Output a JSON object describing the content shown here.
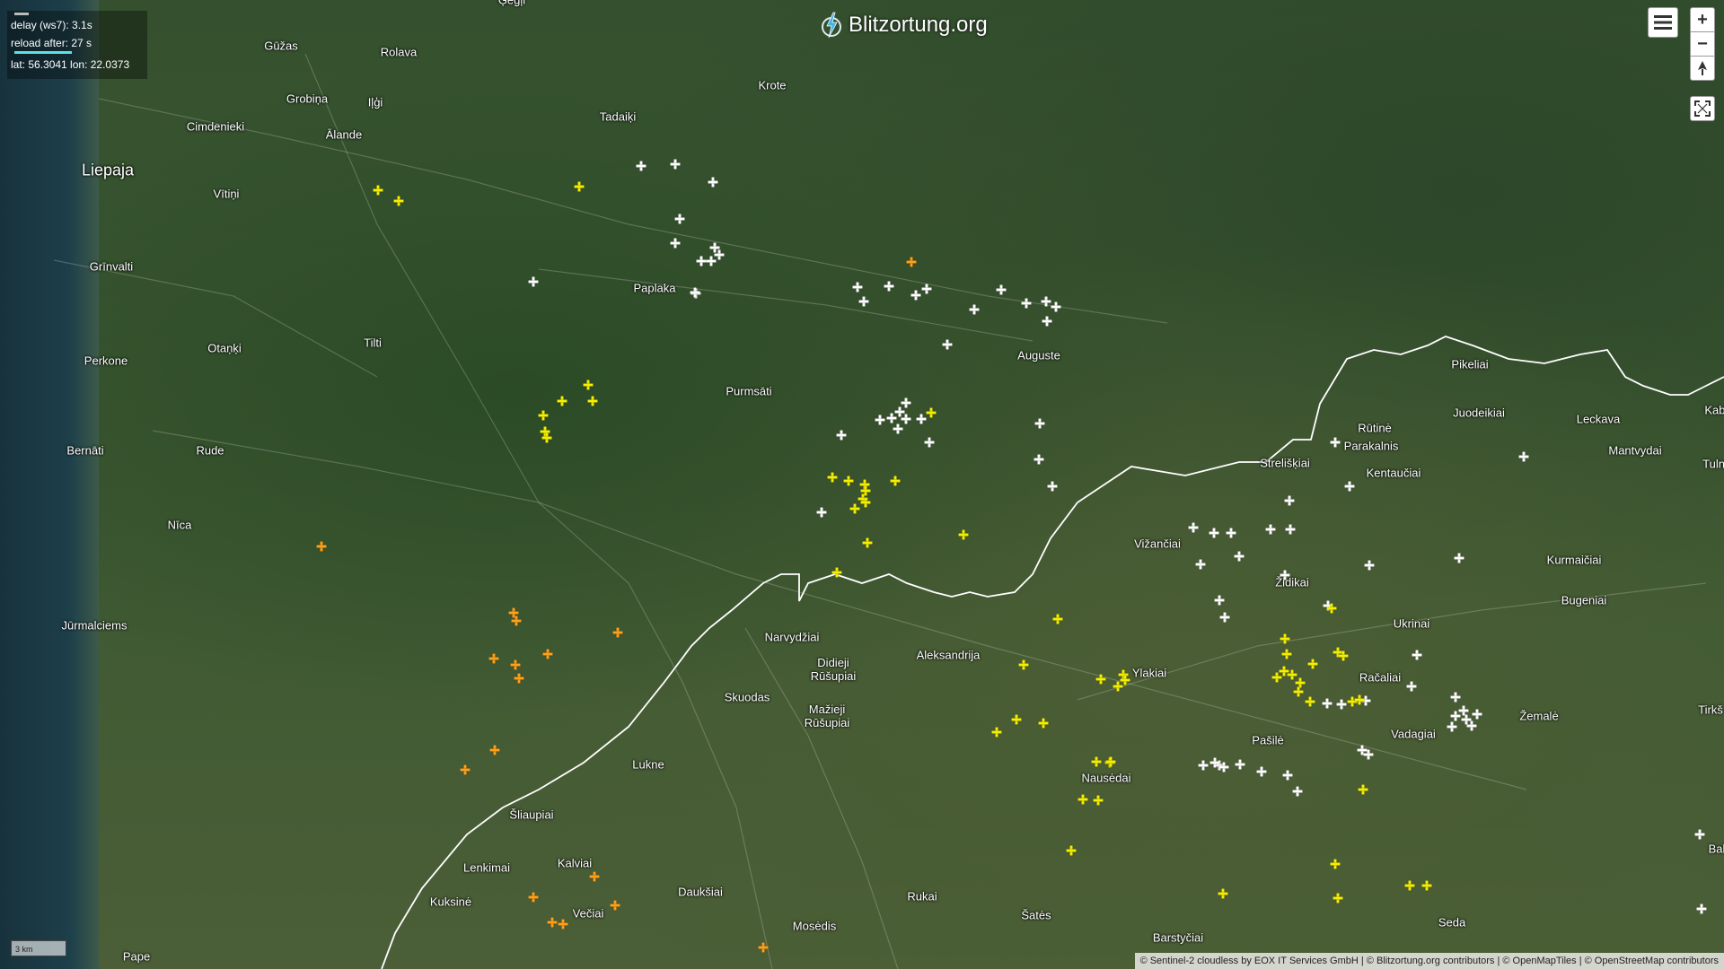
{
  "app": {
    "title": "Blitzortung.org"
  },
  "info": {
    "delay": "delay (ws7): 3.1s",
    "reload": "reload after: 27 s",
    "coords": "lat: 56.3041 lon: 22.0373"
  },
  "controls": {
    "menu_icon": "hamburger-menu-icon",
    "zoom_in": "+",
    "zoom_out": "−",
    "compass_icon": "north-arrow-icon",
    "fullscreen_icon": "fullscreen-icon"
  },
  "scale": {
    "label": "3 km"
  },
  "attribution": "© Sentinel-2 cloudless by EOX IT Services GmbH | © Blitzortung.org contributors | © OpenMapTiles | © OpenStreetMap contributors",
  "places": [
    {
      "name": "Liepaja",
      "big": true
    },
    {
      "name": "Ģegļi"
    },
    {
      "name": "Gūžas"
    },
    {
      "name": "Rolava"
    },
    {
      "name": "Grobiņa"
    },
    {
      "name": "Iļģi"
    },
    {
      "name": "Krote"
    },
    {
      "name": "Tadaiķi"
    },
    {
      "name": "Cimdenieki"
    },
    {
      "name": "Ālande"
    },
    {
      "name": "Vītiņi"
    },
    {
      "name": "Grīnvalti"
    },
    {
      "name": "Paplaka"
    },
    {
      "name": "Perkone"
    },
    {
      "name": "Otaņķi"
    },
    {
      "name": "Tilti"
    },
    {
      "name": "Auguste"
    },
    {
      "name": "Purmsāti"
    },
    {
      "name": "Bernāti"
    },
    {
      "name": "Rude"
    },
    {
      "name": "Nīca"
    },
    {
      "name": "Jūrmalciems"
    },
    {
      "name": "Pikeliai"
    },
    {
      "name": "Juodeikiai"
    },
    {
      "name": "Rūtinė"
    },
    {
      "name": "Parakalnis"
    },
    {
      "name": "Leckava"
    },
    {
      "name": "Kabal"
    },
    {
      "name": "Mantvydai"
    },
    {
      "name": "Tulni"
    },
    {
      "name": "Kentaučiai"
    },
    {
      "name": "Strelišķiai"
    },
    {
      "name": "Vižančiai"
    },
    {
      "name": "Židikai"
    },
    {
      "name": "Kurmaičiai"
    },
    {
      "name": "Bugeniai"
    },
    {
      "name": "Ukrinai"
    },
    {
      "name": "Narvydžiai"
    },
    {
      "name": "Didieji Rūšupiai"
    },
    {
      "name": "Aleksandrija"
    },
    {
      "name": "Ylakiai"
    },
    {
      "name": "Račaliai"
    },
    {
      "name": "Skuodas"
    },
    {
      "name": "Mažieji Rūšupiai"
    },
    {
      "name": "Žemalė"
    },
    {
      "name": "Tirkš"
    },
    {
      "name": "Pašilė"
    },
    {
      "name": "Vadagiai"
    },
    {
      "name": "Lukne"
    },
    {
      "name": "Nausėdai"
    },
    {
      "name": "Šliaupiai"
    },
    {
      "name": "Kalviai"
    },
    {
      "name": "Lenkimai"
    },
    {
      "name": "Kuksinė"
    },
    {
      "name": "Daukšiai"
    },
    {
      "name": "Večiai"
    },
    {
      "name": "Rukai"
    },
    {
      "name": "Šatės"
    },
    {
      "name": "Barstyčiai"
    },
    {
      "name": "Seda"
    },
    {
      "name": "Mosėdis"
    },
    {
      "name": "Pape"
    },
    {
      "name": "Bal"
    }
  ],
  "strikes": {
    "white": 78,
    "yellow": 56,
    "orange": 17
  },
  "colors": {
    "recent": "#ffffff",
    "mid": "#f5f000",
    "old": "#ffa21a"
  }
}
